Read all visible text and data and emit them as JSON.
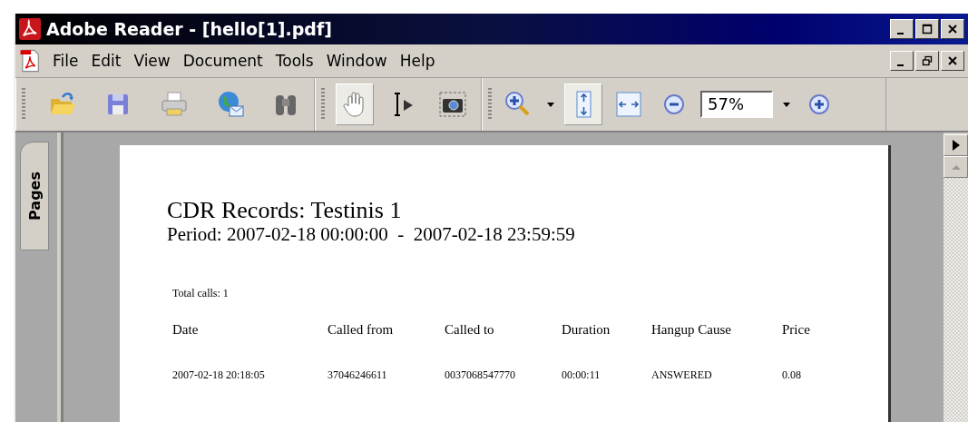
{
  "window": {
    "title": "Adobe Reader - [hello[1].pdf]"
  },
  "menu": [
    "File",
    "Edit",
    "View",
    "Document",
    "Tools",
    "Window",
    "Help"
  ],
  "toolbar": {
    "toggles": [
      {
        "selected": true
      },
      {
        "selected": false
      },
      {
        "selected": false
      },
      {
        "selected": true
      },
      {
        "selected": false
      }
    ],
    "zoom": "57%"
  },
  "side_tab": {
    "label": "Pages"
  },
  "document": {
    "title": "CDR Records: Testinis 1",
    "period": "Period: 2007-02-18 00:00:00  -  2007-02-18 23:59:59",
    "total": "Total calls: 1",
    "table": {
      "columns": [
        "Date",
        "Called from",
        "Called to",
        "Duration",
        "Hangup Cause",
        "Price"
      ],
      "rows": [
        [
          "2007-02-18 20:18:05",
          "37046246611",
          "0037068547770",
          "00:00:11",
          "ANSWERED",
          "0.08"
        ]
      ]
    }
  }
}
